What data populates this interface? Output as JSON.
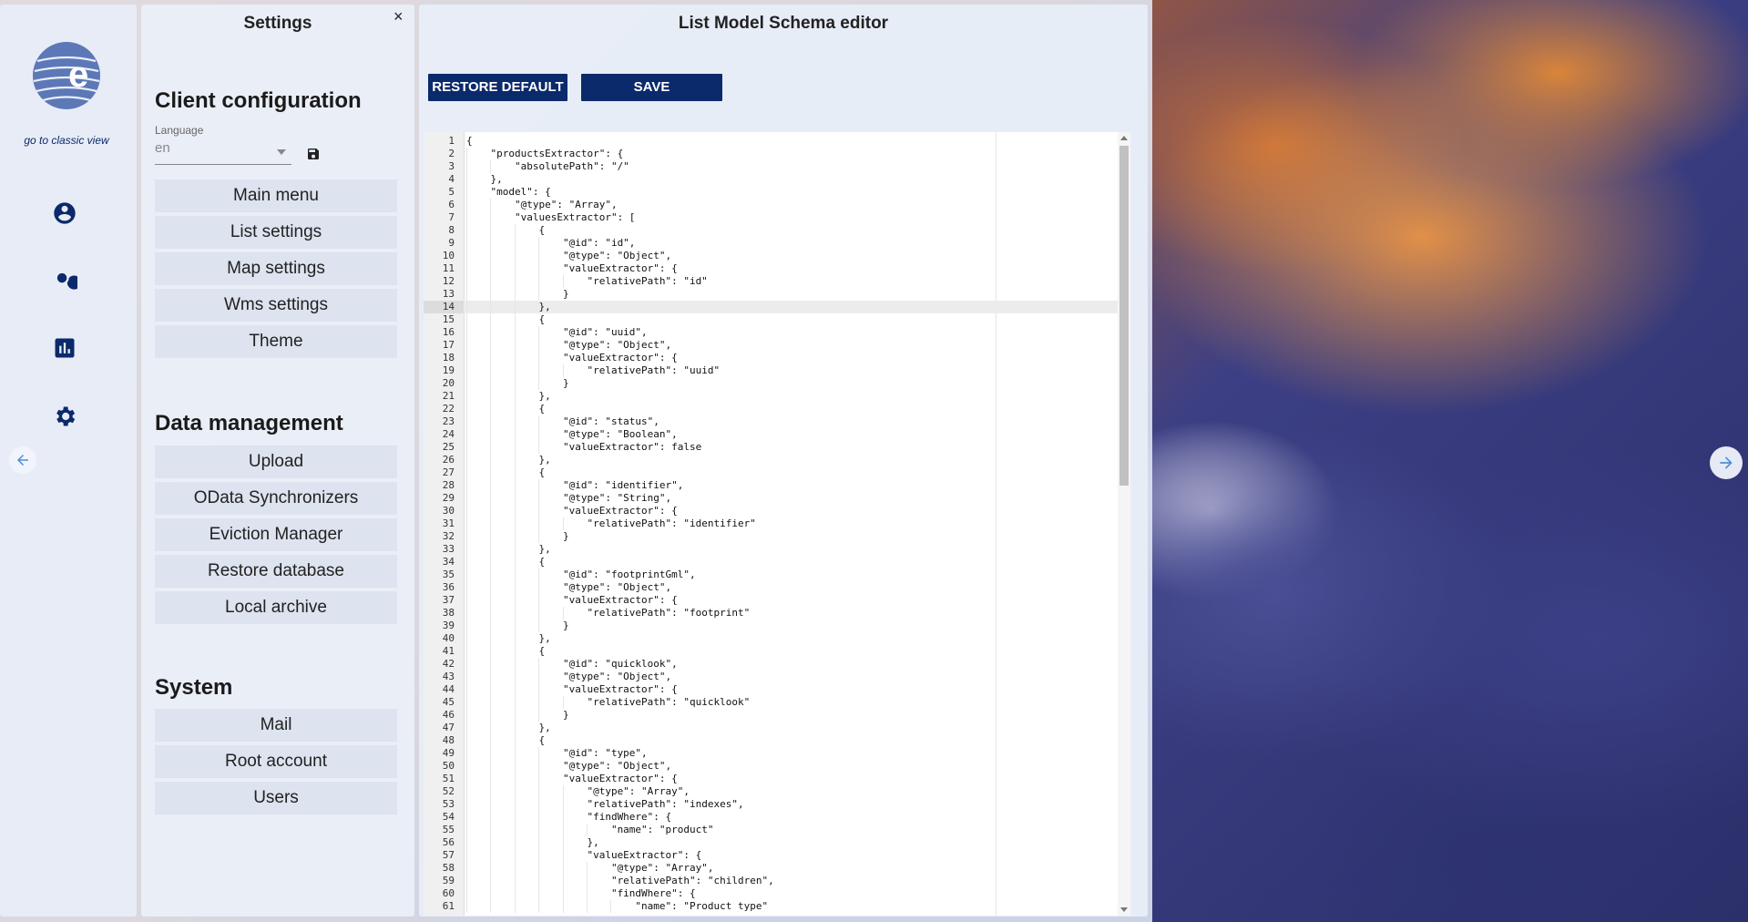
{
  "rail": {
    "classic_link": "go to classic view",
    "icons": [
      "account-icon",
      "search-icon",
      "chart-icon",
      "settings-icon"
    ]
  },
  "settings": {
    "title": "Settings",
    "close": "×",
    "client_section": "Client configuration",
    "language_label": "Language",
    "language_value": "en",
    "client_items": [
      "Main menu",
      "List settings",
      "Map settings",
      "Wms settings",
      "Theme"
    ],
    "data_section": "Data management",
    "data_items": [
      "Upload",
      "OData Synchronizers",
      "Eviction Manager",
      "Restore database",
      "Local archive"
    ],
    "system_section": "System",
    "system_items": [
      "Mail",
      "Root account",
      "Users"
    ]
  },
  "editor": {
    "title": "List Model Schema editor",
    "restore_label": "RESTORE DEFAULT",
    "save_label": "SAVE",
    "active_line": 14,
    "lines": [
      "{",
      "    \"productsExtractor\": {",
      "        \"absolutePath\": \"/\"",
      "    },",
      "    \"model\": {",
      "        \"@type\": \"Array\",",
      "        \"valuesExtractor\": [",
      "            {",
      "                \"@id\": \"id\",",
      "                \"@type\": \"Object\",",
      "                \"valueExtractor\": {",
      "                    \"relativePath\": \"id\"",
      "                }",
      "            },",
      "            {",
      "                \"@id\": \"uuid\",",
      "                \"@type\": \"Object\",",
      "                \"valueExtractor\": {",
      "                    \"relativePath\": \"uuid\"",
      "                }",
      "            },",
      "            {",
      "                \"@id\": \"status\",",
      "                \"@type\": \"Boolean\",",
      "                \"valueExtractor\": false",
      "            },",
      "            {",
      "                \"@id\": \"identifier\",",
      "                \"@type\": \"String\",",
      "                \"valueExtractor\": {",
      "                    \"relativePath\": \"identifier\"",
      "                }",
      "            },",
      "            {",
      "                \"@id\": \"footprintGml\",",
      "                \"@type\": \"Object\",",
      "                \"valueExtractor\": {",
      "                    \"relativePath\": \"footprint\"",
      "                }",
      "            },",
      "            {",
      "                \"@id\": \"quicklook\",",
      "                \"@type\": \"Object\",",
      "                \"valueExtractor\": {",
      "                    \"relativePath\": \"quicklook\"",
      "                }",
      "            },",
      "            {",
      "                \"@id\": \"type\",",
      "                \"@type\": \"Object\",",
      "                \"valueExtractor\": {",
      "                    \"@type\": \"Array\",",
      "                    \"relativePath\": \"indexes\",",
      "                    \"findWhere\": {",
      "                        \"name\": \"product\"",
      "                    },",
      "                    \"valueExtractor\": {",
      "                        \"@type\": \"Array\",",
      "                        \"relativePath\": \"children\",",
      "                        \"findWhere\": {",
      "                            \"name\": \"Product type\""
    ]
  }
}
